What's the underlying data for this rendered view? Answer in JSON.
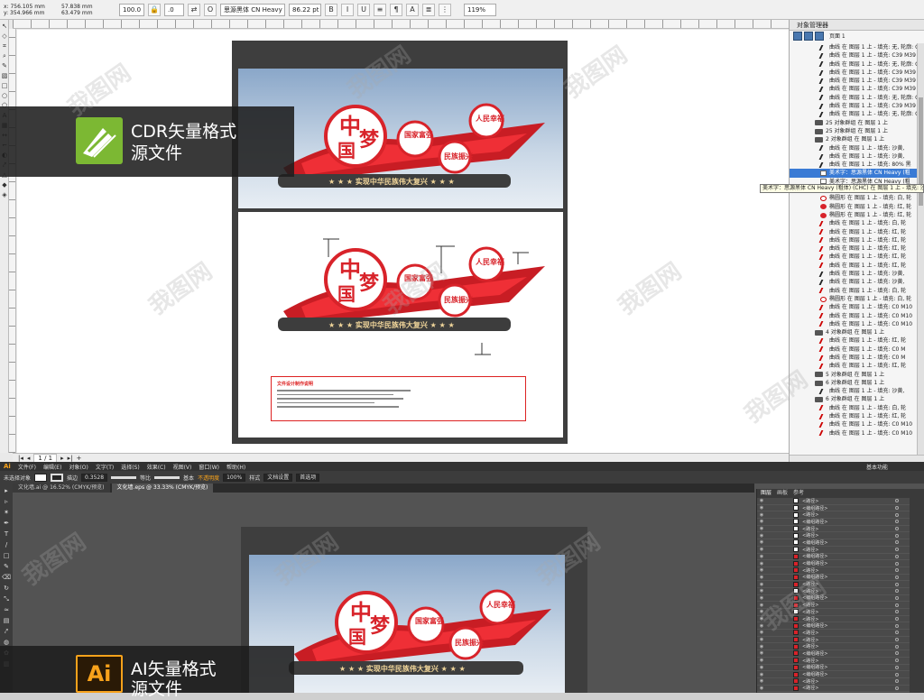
{
  "cdr": {
    "coord_x": "x: 756.105 mm",
    "coord_y": "y: 354.966 mm",
    "coord_w": "57.838 mm",
    "coord_h": "63.479 mm",
    "scale_x": "100.0",
    "scale_y": "100.0",
    "angle": ".0",
    "font_name": "思源黑体 CN Heavy",
    "font_size": "86.22 pt",
    "zoom": "119%",
    "page_nav": "1 / 1",
    "om_title": "对象管理器",
    "om_root": "页面 1",
    "tooltip": "美术字：思源黑体 CN Heavy (粗体) (CHC) 在 图层 1 上 - 填充: 沙黄",
    "om_rows": [
      {
        "text": "曲线 在 图层 1 上 - 填充: 无, 轮廓: C",
        "icon": "curve"
      },
      {
        "text": "曲线 在 图层 1 上 - 填充: C39 M39 Y",
        "icon": "curve"
      },
      {
        "text": "曲线 在 图层 1 上 - 填充: 无, 轮廓: C",
        "icon": "curve"
      },
      {
        "text": "曲线 在 图层 1 上 - 填充: C39 M39 Y",
        "icon": "curve"
      },
      {
        "text": "曲线 在 图层 1 上 - 填充: C39 M39 Y",
        "icon": "curve"
      },
      {
        "text": "曲线 在 图层 1 上 - 填充: C39 M39 Y",
        "icon": "curve"
      },
      {
        "text": "曲线 在 图层 1 上 - 填充: 无, 轮廓: C",
        "icon": "curve"
      },
      {
        "text": "曲线 在 图层 1 上 - 填充: C39 M39 Y",
        "icon": "curve"
      },
      {
        "text": "曲线 在 图层 1 上 - 填充: 无, 轮廓: C",
        "icon": "curve"
      },
      {
        "text": "25 对象群组 在 图层 1 上",
        "icon": "group"
      },
      {
        "text": "25 对象群组 在 图层 1 上",
        "icon": "group"
      },
      {
        "text": "2 对象群组 在 图层 1 上",
        "icon": "group"
      },
      {
        "text": "曲线 在 图层 1 上 - 填充: 沙黄,",
        "icon": "curve"
      },
      {
        "text": "曲线 在 图层 1 上 - 填充: 沙黄,",
        "icon": "curve"
      },
      {
        "text": "曲线 在 图层 1 上 - 填充: 80% 黑",
        "icon": "curve"
      },
      {
        "text": "美术字：思源黑体 CN Heavy (粗",
        "icon": "text",
        "selected": true
      },
      {
        "text": "美术字：思源黑体 CN Heavy (粗",
        "icon": "text"
      },
      {
        "text": "椭圆形 在 图层 1 上 - 填充: 红, 轮",
        "icon": "ellipse"
      },
      {
        "text": "椭圆形 在 图层 1 上 - 填充: 白, 轮",
        "icon": "ellipse-w"
      },
      {
        "text": "椭圆形 在 图层 1 上 - 填充: 红, 轮",
        "icon": "ellipse"
      },
      {
        "text": "椭圆形 在 图层 1 上 - 填充: 红, 轮",
        "icon": "ellipse"
      },
      {
        "text": "曲线 在 图层 1 上 - 填充: 白, 轮",
        "icon": "curve-r"
      },
      {
        "text": "曲线 在 图层 1 上 - 填充: 红, 轮",
        "icon": "curve-r"
      },
      {
        "text": "曲线 在 图层 1 上 - 填充: 红, 轮",
        "icon": "curve-r"
      },
      {
        "text": "曲线 在 图层 1 上 - 填充: 红, 轮",
        "icon": "curve-r"
      },
      {
        "text": "曲线 在 图层 1 上 - 填充: 红, 轮",
        "icon": "curve-r"
      },
      {
        "text": "曲线 在 图层 1 上 - 填充: 红, 轮",
        "icon": "curve-r"
      },
      {
        "text": "曲线 在 图层 1 上 - 填充: 沙黄,",
        "icon": "curve"
      },
      {
        "text": "曲线 在 图层 1 上 - 填充: 沙黄,",
        "icon": "curve"
      },
      {
        "text": "曲线 在 图层 1 上 - 填充: 白, 轮",
        "icon": "curve-r"
      },
      {
        "text": "椭圆形 在 图层 1 上 - 填充: 白, 轮",
        "icon": "ellipse-w"
      },
      {
        "text": "曲线 在 图层 1 上 - 填充: C0 M10",
        "icon": "curve-r"
      },
      {
        "text": "曲线 在 图层 1 上 - 填充: C0 M10",
        "icon": "curve-r"
      },
      {
        "text": "曲线 在 图层 1 上 - 填充: C0 M10",
        "icon": "curve-r"
      },
      {
        "text": "4 对象群组 在 图层 1 上",
        "icon": "group"
      },
      {
        "text": "曲线 在 图层 1 上 - 填充: 红, 轮",
        "icon": "curve-r"
      },
      {
        "text": "曲线 在 图层 1 上 - 填充: C0 M",
        "icon": "curve-r"
      },
      {
        "text": "曲线 在 图层 1 上 - 填充: C0 M",
        "icon": "curve-r"
      },
      {
        "text": "曲线 在 图层 1 上 - 填充: 红, 轮",
        "icon": "curve-r"
      },
      {
        "text": "5 对象群组 在 图层 1 上",
        "icon": "group"
      },
      {
        "text": "6 对象群组 在 图层 1 上",
        "icon": "group"
      },
      {
        "text": "曲线 在 图层 1 上 - 填充: 沙黄,",
        "icon": "curve"
      },
      {
        "text": "6 对象群组 在 图层 1 上",
        "icon": "group"
      },
      {
        "text": "曲线 在 图层 1 上 - 填充: 白, 轮",
        "icon": "curve-r"
      },
      {
        "text": "曲线 在 图层 1 上 - 填充: 红, 轮",
        "icon": "curve-r"
      },
      {
        "text": "曲线 在 图层 1 上 - 填充: C0 M10",
        "icon": "curve-r"
      },
      {
        "text": "曲线 在 图层 1 上 - 填充: C0 M10",
        "icon": "curve-r"
      }
    ]
  },
  "artwork": {
    "slogan": "★ ★ ★ 实现中华民族伟大复兴 ★ ★ ★",
    "big1": "中",
    "big2": "梦",
    "big3": "国",
    "circle1": "国家富强",
    "circle2": "民族振兴",
    "circle3": "人民幸福",
    "notes_title": "文件设计制作说明"
  },
  "labels": {
    "cdr": [
      "CDR矢量格式",
      "源文件"
    ],
    "ai": [
      "AI矢量格式",
      "源文件"
    ]
  },
  "watermark": "我图网",
  "ai": {
    "logo": "Ai",
    "menus": [
      "文件(F)",
      "编辑(E)",
      "对象(O)",
      "文字(T)",
      "选择(S)",
      "效果(C)",
      "视图(V)",
      "窗口(W)",
      "帮助(H)"
    ],
    "workspace": "基本功能",
    "ctrl_label": "未选择对象",
    "ctrl_stroke_label": "描边",
    "ctrl_stroke_value": "0.3528",
    "ctrl_line": "等比",
    "ctrl_base": "基本",
    "ctrl_opacity_label": "不透明度",
    "ctrl_opacity": "100%",
    "ctrl_style": "样式",
    "ctrl_doc_setup": "文档设置",
    "ctrl_prefs": "首选项",
    "tabs": [
      "文化墙.ai @ 16.52% (CMYK/预览)",
      "文化墙.eps @ 33.33% (CMYK/预览)"
    ],
    "panel_tabs": [
      "图层",
      "画板",
      "参考"
    ],
    "layer_rows": [
      {
        "name": "<路径>",
        "red": false
      },
      {
        "name": "<编组路径>",
        "red": false
      },
      {
        "name": "<路径>",
        "red": false
      },
      {
        "name": "<编组路径>",
        "red": false
      },
      {
        "name": "<路径>",
        "red": false
      },
      {
        "name": "<路径>",
        "red": false
      },
      {
        "name": "<编组路径>",
        "red": false
      },
      {
        "name": "<路径>",
        "red": false
      },
      {
        "name": "<编组路径>",
        "red": true
      },
      {
        "name": "<编组路径>",
        "red": true
      },
      {
        "name": "<路径>",
        "red": true
      },
      {
        "name": "<编组路径>",
        "red": true
      },
      {
        "name": "<路径>",
        "red": true
      },
      {
        "name": "<路径>",
        "red": false
      },
      {
        "name": "<编组路径>",
        "red": true
      },
      {
        "name": "<路径>",
        "red": true
      },
      {
        "name": "<路径>",
        "red": false
      },
      {
        "name": "<路径>",
        "red": true
      },
      {
        "name": "<编组路径>",
        "red": true
      },
      {
        "name": "<路径>",
        "red": true
      },
      {
        "name": "<路径>",
        "red": true
      },
      {
        "name": "<路径>",
        "red": true
      },
      {
        "name": "<编组路径>",
        "red": true
      },
      {
        "name": "<路径>",
        "red": true
      },
      {
        "name": "<编组路径>",
        "red": true
      },
      {
        "name": "<编组路径>",
        "red": true
      },
      {
        "name": "<路径>",
        "red": true
      },
      {
        "name": "<路径>",
        "red": true
      }
    ]
  },
  "colors": {
    "red": "#d8232a",
    "ai_orange": "#f7a21b",
    "cdr_green": "#7cb833"
  }
}
